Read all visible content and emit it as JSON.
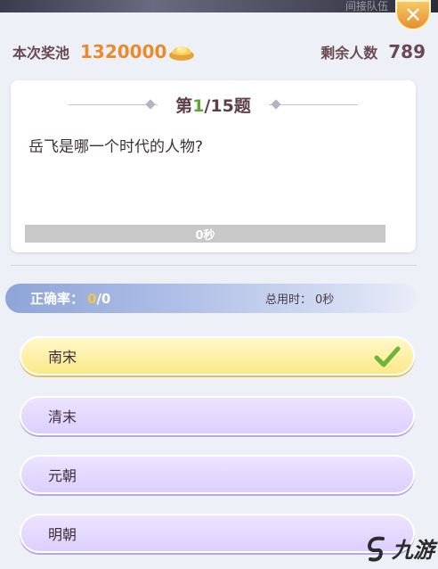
{
  "top": {
    "faded_text": "间接队伍",
    "close_symbol": "✕"
  },
  "header": {
    "pool_label": "本次奖池",
    "pool_value": "1320000",
    "remaining_label": "剩余人数",
    "remaining_value": "789"
  },
  "question": {
    "prefix": "第",
    "current": "1",
    "suffix": "/15题",
    "text": "岳飞是哪一个时代的人物?",
    "timer_text": "0秒"
  },
  "stats": {
    "accuracy_label": "正确率：",
    "accuracy_correct": "0",
    "accuracy_rest": "/0",
    "total_time_label": "总用时：",
    "total_time_value": "0秒"
  },
  "options": [
    {
      "label": "南宋",
      "selected": true
    },
    {
      "label": "清末",
      "selected": false
    },
    {
      "label": "元朝",
      "selected": false
    },
    {
      "label": "明朝",
      "selected": false
    }
  ],
  "watermark": {
    "text": "九游"
  },
  "colors": {
    "pool_value": "#e98a2c",
    "current_question": "#59a832",
    "accuracy_number": "#f3c64a",
    "check": "#6fb43a",
    "selected_option": "#fbe98a",
    "option": "#dccfff"
  }
}
